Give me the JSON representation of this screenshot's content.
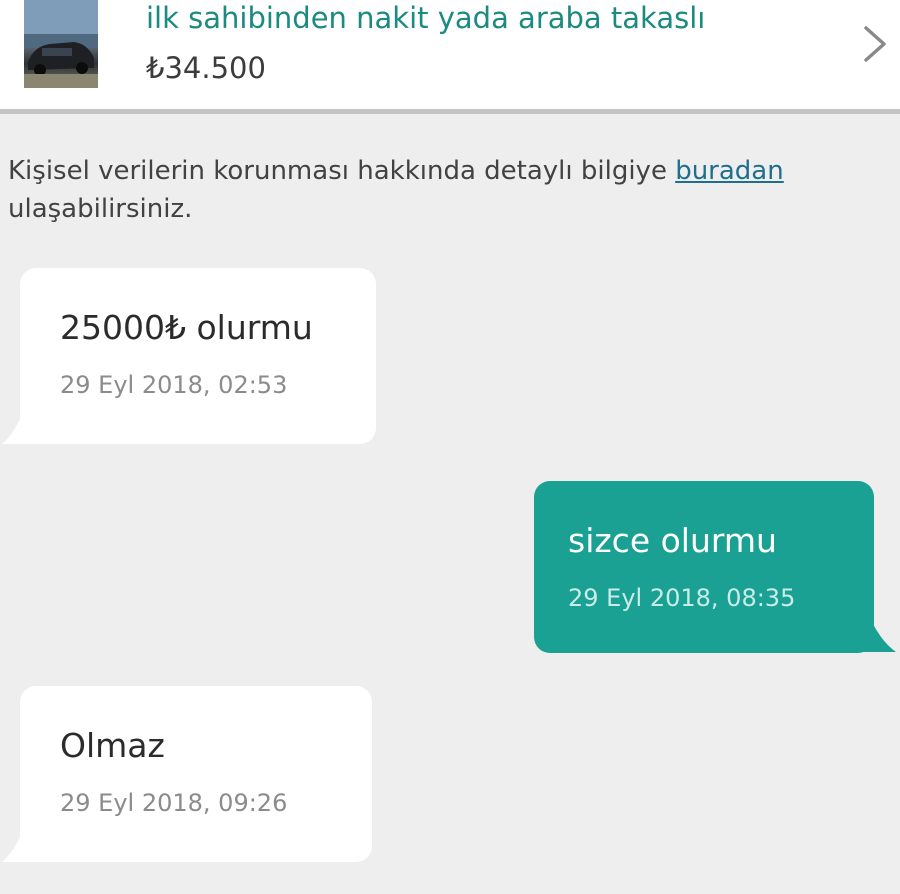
{
  "listing": {
    "title": "ilk sahibinden nakit yada araba takaslı",
    "price": "₺34.500",
    "thumbnail_icon": "listing-photo",
    "chevron_icon": "chevron-right-icon"
  },
  "privacy": {
    "text": "Kişisel verilerin korunması hakkında detaylı bilgiye ",
    "link_label": "buradan",
    "text_after": "ulaşabilirsiniz."
  },
  "messages": [
    {
      "direction": "incoming",
      "text": "25000₺ olurmu",
      "time": "29 Eyl 2018, 02:53"
    },
    {
      "direction": "outgoing",
      "text": "sizce olurmu",
      "time": "29 Eyl 2018, 08:35"
    },
    {
      "direction": "incoming",
      "text": "Olmaz",
      "time": "29 Eyl 2018, 09:26"
    }
  ],
  "colors": {
    "accent": "#1aa193",
    "title_teal": "#1b8a80",
    "link": "#1f6f8c",
    "background": "#eeeeee",
    "incoming_bubble": "#ffffff"
  }
}
